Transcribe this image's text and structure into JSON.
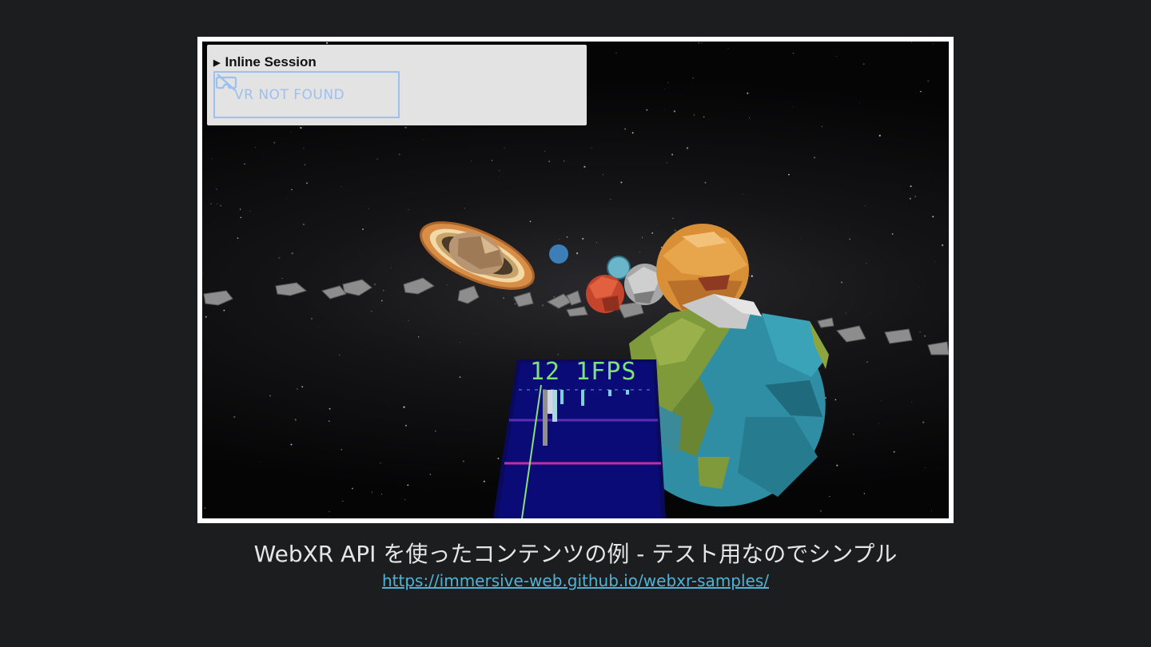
{
  "session_panel": {
    "title": "Inline Session",
    "vr_button_label": "VR NOT FOUND",
    "vr_icon": "vr-headset-off-icon"
  },
  "scene": {
    "fps_readout": "12 1FPS"
  },
  "caption": {
    "text": "WebXR API を使ったコンテンツの例 - テスト用なのでシンプル",
    "link": "https://immersive-web.github.io/webxr-samples/"
  }
}
